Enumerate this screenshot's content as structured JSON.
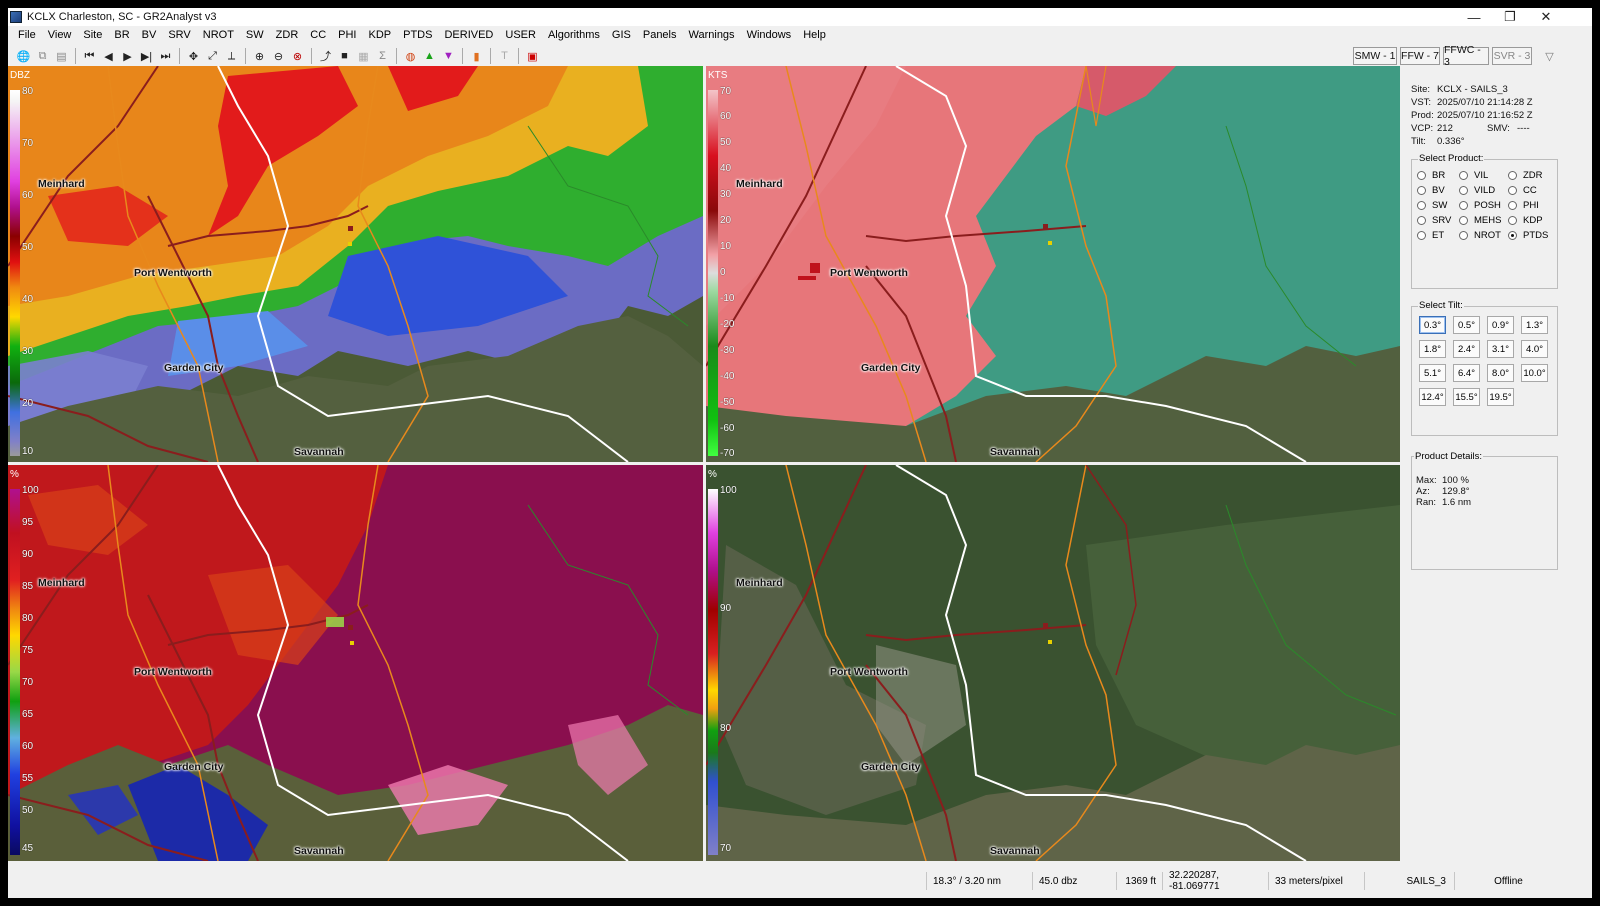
{
  "window": {
    "title": "KCLX Charleston, SC - GR2Analyst v3",
    "controls": [
      "—",
      "❐",
      "✕"
    ]
  },
  "menu": [
    "File",
    "View",
    "Site",
    "BR",
    "BV",
    "SRV",
    "NROT",
    "SW",
    "ZDR",
    "CC",
    "PHI",
    "KDP",
    "PTDS",
    "DERIVED",
    "USER",
    "Algorithms",
    "GIS",
    "Panels",
    "Warnings",
    "Windows",
    "Help"
  ],
  "warning_buttons": [
    {
      "label": "SMW - 1"
    },
    {
      "label": "FFW - 7"
    },
    {
      "label": "FFWC - 3"
    },
    {
      "label": "SVR - 3"
    }
  ],
  "places": {
    "meinhard": "Meinhard",
    "port_wentworth": "Port Wentworth",
    "garden_city": "Garden City",
    "savannah": "Savannah"
  },
  "panels": {
    "reflectivity": {
      "unit": "DBZ",
      "ticks": [
        "80",
        "70",
        "60",
        "50",
        "40",
        "30",
        "20",
        "10"
      ]
    },
    "velocity": {
      "unit": "KTS",
      "ticks": [
        "70",
        "60",
        "50",
        "40",
        "30",
        "20",
        "10",
        "0",
        "-10",
        "-20",
        "-30",
        "-40",
        "-50",
        "-60",
        "-70"
      ]
    },
    "cc": {
      "unit": "%",
      "ticks": [
        "100",
        "95",
        "90",
        "85",
        "80",
        "75",
        "70",
        "65",
        "60",
        "55",
        "50",
        "45"
      ]
    },
    "ptds": {
      "unit": "%",
      "ticks": [
        "100",
        "90",
        "80",
        "70"
      ]
    }
  },
  "info": {
    "site_label": "Site:",
    "site": "KCLX - SAILS_3",
    "vst_label": "VST:",
    "vst": "2025/07/10  21:14:28 Z",
    "prod_label": "Prod:",
    "prod": "2025/07/10  21:16:52 Z",
    "vcp_label": "VCP:",
    "vcp": "212",
    "smv_label": "SMV:",
    "smv": "----",
    "tilt_label": "Tilt:",
    "tilt": "0.336°"
  },
  "select_product": {
    "title": "Select Product:",
    "options": [
      "BR",
      "VIL",
      "ZDR",
      "BV",
      "VILD",
      "CC",
      "SW",
      "POSH",
      "PHI",
      "SRV",
      "MEHS",
      "KDP",
      "ET",
      "NROT",
      "PTDS"
    ],
    "selected": "PTDS"
  },
  "select_tilt": {
    "title": "Select Tilt:",
    "options": [
      "0.3°",
      "0.5°",
      "0.9°",
      "1.3°",
      "1.8°",
      "2.4°",
      "3.1°",
      "4.0°",
      "5.1°",
      "6.4°",
      "8.0°",
      "10.0°",
      "12.4°",
      "15.5°",
      "19.5°"
    ],
    "selected": "0.3°"
  },
  "product_details": {
    "title": "Product Details:",
    "max_label": "Max:",
    "max": "100 %",
    "az_label": "Az:",
    "az": "129.8°",
    "ran_label": "Ran:",
    "ran": "1.6 nm"
  },
  "status": {
    "az_range": "18.3° / 3.20 nm",
    "value": "45.0 dbz",
    "height": "1369 ft",
    "coords": "32.220287, -81.069771",
    "scale": "33 meters/pixel",
    "mode": "SAILS_3",
    "connection": "Offline"
  },
  "colors": {
    "background_terrain": "#4a5a34",
    "road_highway": "#8a1d1d",
    "road_secondary": "#e8891c",
    "county_line": "#ffffff",
    "velocity_inbound": "#3fae8a",
    "velocity_outbound": "#e7767a",
    "cc_field": "#8a0f4e"
  }
}
